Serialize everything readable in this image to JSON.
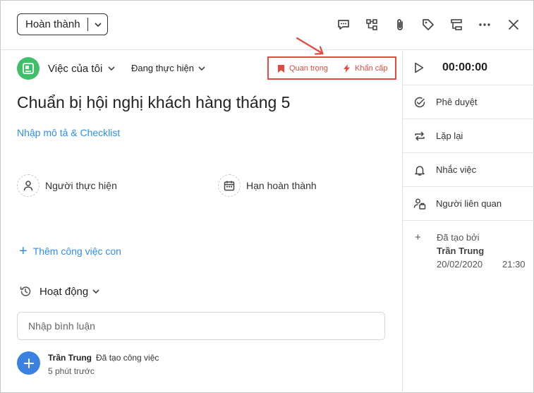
{
  "header": {
    "status_label": "Hoàn thành",
    "tools": [
      "comment-icon",
      "subtask-tree-icon",
      "attachment-icon",
      "tag-icon",
      "workflow-icon",
      "more-icon",
      "close-icon"
    ]
  },
  "task": {
    "list_name": "Việc của tôi",
    "progress_label": "Đang thực hiện",
    "priority_important": "Quan trọng",
    "priority_urgent": "Khẩn cấp",
    "title": "Chuẩn bị hội nghị khách hàng tháng 5",
    "description_link": "Nhập mô tả & Checklist",
    "assignee_label": "Người thực hiện",
    "deadline_label": "Hạn hoàn thành",
    "add_subtask": "Thêm công việc con",
    "activity_label": "Hoạt động",
    "comment_placeholder": "Nhập bình luận"
  },
  "activity_log": {
    "user": "Trần Trung",
    "action": "Đã tạo công việc",
    "time": "5 phút trước"
  },
  "sidebar": {
    "timer": "00:00:00",
    "approve": "Phê duyệt",
    "repeat": "Lặp lại",
    "remind": "Nhắc việc",
    "related": "Người liên quan",
    "created_by_label": "Đã tạo bởi",
    "created_by_user": "Trần Trung",
    "created_date": "20/02/2020",
    "created_time": "21:30"
  },
  "colors": {
    "accent_blue": "#2e8de8",
    "priority_red": "#e04a3f",
    "list_green": "#3fbf6a"
  }
}
